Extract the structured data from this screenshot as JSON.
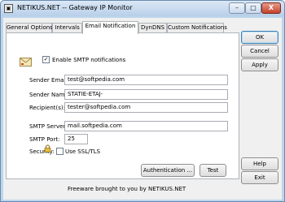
{
  "window": {
    "title": "NETIKUS.NET -- Gateway IP Monitor",
    "minimize": "–",
    "maximize": "□",
    "close": "X"
  },
  "tabs": [
    {
      "label": "General Options",
      "active": false
    },
    {
      "label": "Intervals",
      "active": false
    },
    {
      "label": "Email Notification",
      "active": true
    },
    {
      "label": "DynDNS",
      "active": false
    },
    {
      "label": "Custom Notifications",
      "active": false
    }
  ],
  "email": {
    "enable_label": "Enable SMTP notifications",
    "enable_checked": "✓",
    "sender_email_label": "Sender Email:",
    "sender_email_value": "test@softpedia.com",
    "sender_name_label": "Sender Name:",
    "sender_name_value": "STATIE-ETAJ-",
    "recipients_label": "Recipient(s):",
    "recipients_value": "tester@softpedia.com",
    "smtp_server_label": "SMTP Server:",
    "smtp_server_value": "mail.softpedia.com",
    "smtp_port_label": "SMTP Port:",
    "smtp_port_value": "25",
    "security_label": "Security:",
    "ssl_label": "Use SSL/TLS",
    "ssl_checked": "",
    "authentication_button": "Authentication ...",
    "test_button": "Test"
  },
  "side_buttons": {
    "ok": "OK",
    "cancel": "Cancel",
    "apply": "Apply",
    "help": "Help",
    "exit": "Exit"
  },
  "footer": "Freeware brought to you by NETIKUS.NET",
  "colors": {
    "titlebar": "#bcd5ec",
    "client_bg": "#f0f0f0",
    "panel_bg": "#ffffff",
    "close_button": "#c4422b"
  }
}
